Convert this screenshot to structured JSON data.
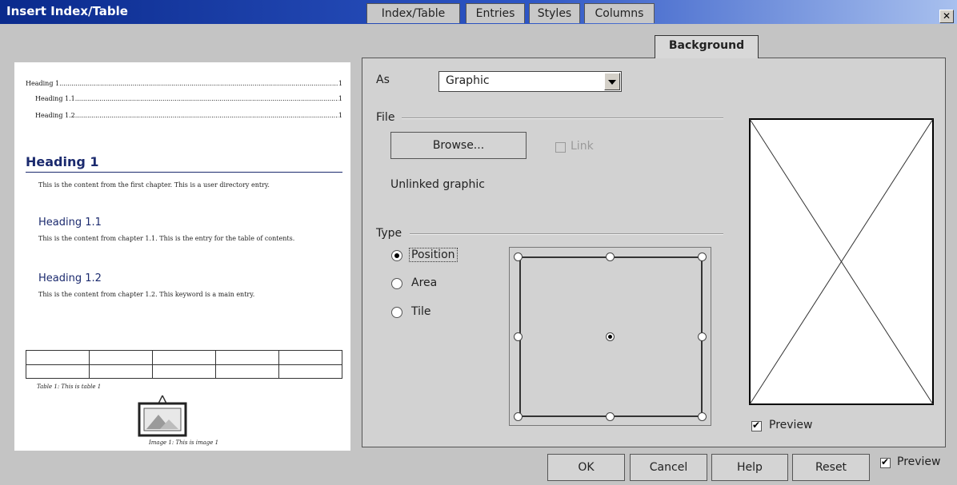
{
  "window": {
    "title": "Insert Index/Table",
    "close_glyph": "✕"
  },
  "preview_page": {
    "toc": [
      {
        "text": "Heading 1",
        "page": "1"
      },
      {
        "text": "Heading 1.1",
        "page": "1"
      },
      {
        "text": "Heading 1.2",
        "page": "1"
      }
    ],
    "heading1": "Heading 1",
    "text1": "This is the content from the first chapter. This is a user directory entry.",
    "heading11": "Heading 1.1",
    "text11": "This is the content from chapter 1.1. This is the entry for the table of contents.",
    "heading12": "Heading 1.2",
    "text12": "This is the content from chapter 1.2. This keyword is a main entry.",
    "table_caption": "Table 1: This is table 1",
    "image_caption": "Image 1: This is image 1"
  },
  "tabs": [
    "Index/Table",
    "Entries",
    "Styles",
    "Columns",
    "Background"
  ],
  "active_tab": "Background",
  "background": {
    "as_label": "As",
    "as_value": "Graphic",
    "file_label": "File",
    "browse_label": "Browse...",
    "link_label": "Link",
    "link_checked": false,
    "file_status": "Unlinked graphic",
    "type_label": "Type",
    "type_options": [
      {
        "label": "Position",
        "selected": true
      },
      {
        "label": "Area",
        "selected": false
      },
      {
        "label": "Tile",
        "selected": false
      }
    ],
    "selected_position": "center",
    "graphic_preview_label": "Preview",
    "graphic_preview_checked": true
  },
  "footer": {
    "ok": "OK",
    "cancel": "Cancel",
    "help": "Help",
    "reset": "Reset",
    "preview": "Preview",
    "preview_checked": true
  },
  "colors": {
    "title_start": "#0a2a8c",
    "heading_blue": "#1b2a6e",
    "dialog_bg": "#c4c4c4"
  }
}
